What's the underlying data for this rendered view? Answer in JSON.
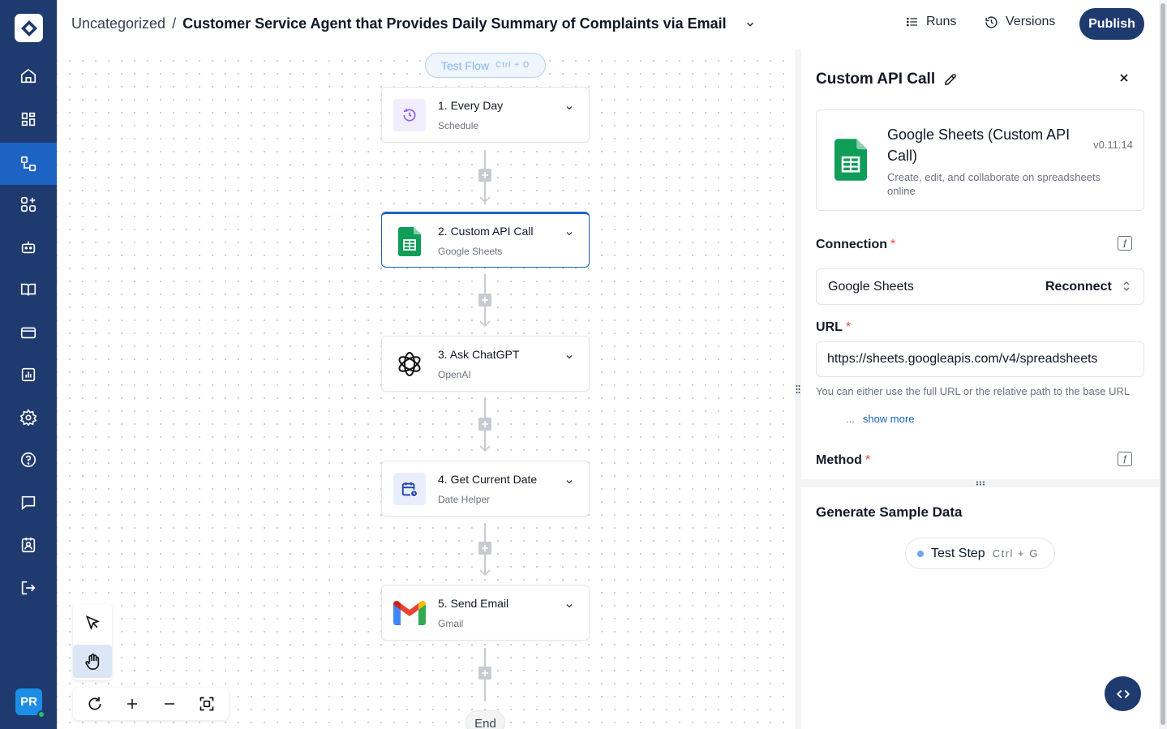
{
  "topbar": {
    "folder": "Uncategorized",
    "separator": "/",
    "flow_name": "Customer Service Agent that Provides Daily Summary of Complaints via Email",
    "runs_label": "Runs",
    "versions_label": "Versions",
    "publish_label": "Publish"
  },
  "sidebar": {
    "items": [
      "home-icon",
      "dashboard-icon",
      "flows-icon",
      "apps-icon",
      "bot-icon",
      "book-icon",
      "billing-icon",
      "analytics-icon",
      "settings-icon",
      "help-icon",
      "chat-icon",
      "contacts-icon",
      "logout-icon"
    ],
    "active_item": "flows-icon",
    "avatar_initials": "PR"
  },
  "canvas": {
    "test_flow_label": "Test Flow",
    "test_flow_shortcut": "Ctrl + D",
    "end_label": "End",
    "steps": [
      {
        "title": "1. Every Day",
        "subtitle": "Schedule"
      },
      {
        "title": "2. Custom API Call",
        "subtitle": "Google Sheets"
      },
      {
        "title": "3. Ask ChatGPT",
        "subtitle": "OpenAI"
      },
      {
        "title": "4. Get Current Date",
        "subtitle": "Date Helper"
      },
      {
        "title": "5. Send Email",
        "subtitle": "Gmail"
      }
    ],
    "selected_step": "2. Custom API Call"
  },
  "panel": {
    "title": "Custom API Call",
    "piece": {
      "name": "Google Sheets (Custom API Call)",
      "version": "v0.11.14",
      "description": "Create, edit, and collaborate on spreadsheets online"
    },
    "connection": {
      "label": "Connection",
      "required_mark": "*",
      "value": "Google Sheets",
      "action": "Reconnect"
    },
    "url": {
      "label": "URL",
      "required_mark": "*",
      "value": "https://sheets.googleapis.com/v4/spreadsheets",
      "help": "You can either use the full URL or the relative path to the base URL",
      "ellipsis": "...",
      "show_more": "show more"
    },
    "method": {
      "label": "Method",
      "required_mark": "*"
    },
    "sample": {
      "title": "Generate Sample Data",
      "test_step_label": "Test Step",
      "test_step_shortcut": "Ctrl + G"
    }
  },
  "colors": {
    "sidebar_bg": "#1e3a6e",
    "sidebar_active": "#1d63c4",
    "accent": "#1d63c4",
    "required": "#ef4444"
  }
}
